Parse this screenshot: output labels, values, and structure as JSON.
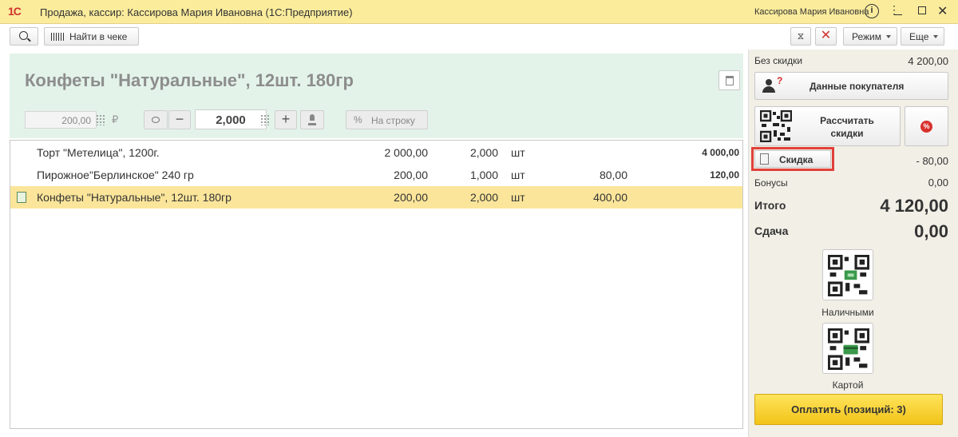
{
  "titlebar": {
    "logo": "1С",
    "title": "Продажа, кассир: Кассирова Мария Ивановна  (1С:Предприятие)",
    "user": "Кассирова Мария Ивановна",
    "info": "i",
    "more": "⋮",
    "close": "✕"
  },
  "toolbar": {
    "find_label": "Найти в чеке",
    "hourglass": "⧖",
    "cancel": "✕",
    "mode_label": "Режим",
    "more_label": "Еще"
  },
  "product": {
    "title": "Конфеты \"Натуральные\", 12шт. 180гр",
    "price": "200,00",
    "currency": "₽",
    "minus": "−",
    "quantity": "2,000",
    "plus": "+",
    "pct": "%",
    "row_discount_label": "На строку"
  },
  "table": {
    "rows": [
      {
        "name": "Торт \"Метелица\", 1200г.",
        "price": "2 000,00",
        "qty": "2,000",
        "unit": "шт",
        "discount": "",
        "sum": "4 000,00"
      },
      {
        "name": "Пирожное\"Берлинское\" 240 гр",
        "price": "200,00",
        "qty": "1,000",
        "unit": "шт",
        "discount": "80,00",
        "sum": "120,00"
      },
      {
        "name": "Конфеты \"Натуральные\", 12шт. 180гр",
        "price": "200,00",
        "qty": "2,000",
        "unit": "шт",
        "discount": "400,00",
        "sum": ""
      }
    ]
  },
  "summary": {
    "no_discount_label": "Без скидки",
    "no_discount_value": "4 200,00",
    "buyer_qmark": "?",
    "buyer_label": "Данные покупателя",
    "calc_label": "Рассчитать скидки",
    "pct_label": "%",
    "discount_label": "Скидка",
    "discount_value": "- 80,00",
    "bonus_label": "Бонусы",
    "bonus_value": "0,00",
    "total_label": "Итого",
    "total_value": "4 120,00",
    "change_label": "Сдача",
    "change_value": "0,00",
    "cash_label": "Наличными",
    "card_label": "Картой",
    "pay_label": "Оплатить (позиций: 3)"
  },
  "colors": {
    "titlebar": "#fbec9c",
    "product_panel": "#e3f3ea",
    "selected_row": "#fbe59a",
    "right_panel": "#f1efe6",
    "pay_button": "#f5cc24",
    "highlight_frame": "#e0413a"
  }
}
